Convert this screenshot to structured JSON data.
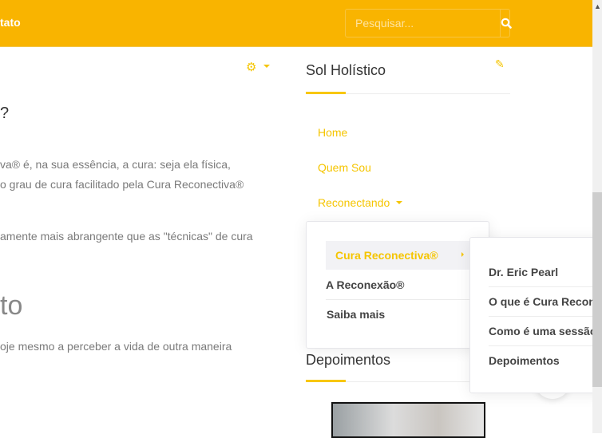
{
  "header": {
    "nav_partial": "tato",
    "search_placeholder": "Pesquisar..."
  },
  "content": {
    "heading_partial": "?",
    "para1_line1": "va® é, na sua essência, a cura: seja ela física,",
    "para1_line2": "o grau de cura facilitado pela Cura Reconectiva®",
    "para2_line1": "amente mais abrangente que as \"técnicas\" de cura",
    "heading2_partial": "to",
    "para3_line1": "oje mesmo a perceber a vida de outra maneira"
  },
  "sidebar": {
    "title": "Sol Holístico",
    "menu": [
      {
        "label": "Home"
      },
      {
        "label": "Quem Sou"
      },
      {
        "label": "Reconectando"
      }
    ],
    "dropdown": [
      {
        "label": "Cura Reconectiva®"
      },
      {
        "label": "A Reconexão®"
      },
      {
        "label": "Saiba mais"
      }
    ],
    "submenu": [
      {
        "label": "Dr. Eric Pearl"
      },
      {
        "label": "O que é Cura Reconectiva®"
      },
      {
        "label": "Como é uma sessão"
      },
      {
        "label": "Depoimentos"
      }
    ],
    "depo_title": "Depoimentos"
  },
  "colors": {
    "brand": "#f9b400",
    "link": "#f5c500"
  }
}
